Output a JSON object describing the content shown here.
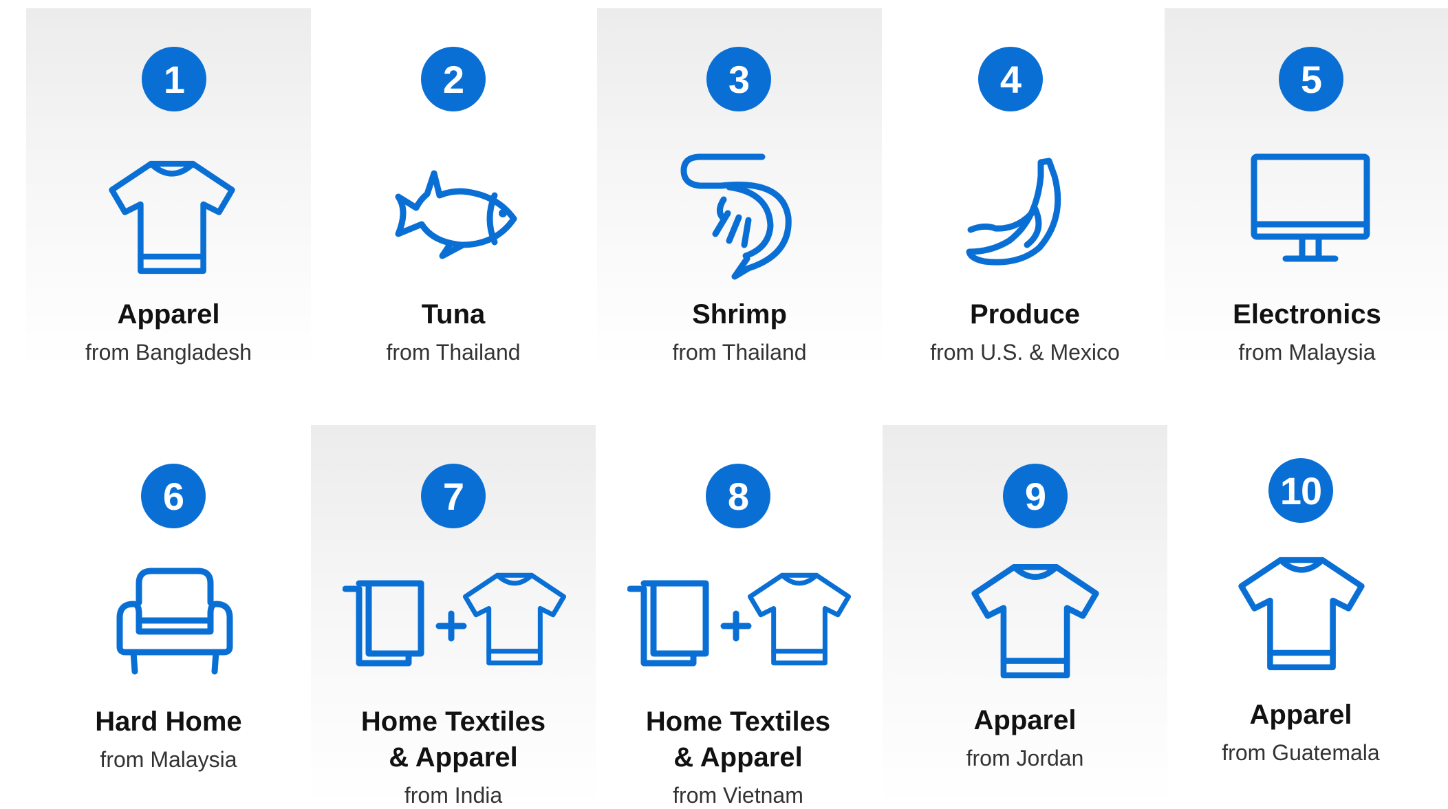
{
  "accent_color": "#0a6fd4",
  "items": [
    {
      "rank": "1",
      "title": "Apparel",
      "origin": "from Bangladesh",
      "icon": "tshirt-icon"
    },
    {
      "rank": "2",
      "title": "Tuna",
      "origin": "from Thailand",
      "icon": "fish-icon"
    },
    {
      "rank": "3",
      "title": "Shrimp",
      "origin": "from Thailand",
      "icon": "shrimp-icon"
    },
    {
      "rank": "4",
      "title": "Produce",
      "origin": "from U.S. & Mexico",
      "icon": "banana-icon"
    },
    {
      "rank": "5",
      "title": "Electronics",
      "origin": "from Malaysia",
      "icon": "monitor-icon"
    },
    {
      "rank": "6",
      "title": "Hard Home",
      "origin": "from Malaysia",
      "icon": "armchair-icon"
    },
    {
      "rank": "7",
      "title_line1": "Home Textiles",
      "title_line2": "& Apparel",
      "origin": "from India",
      "icon": "towel-plus-tshirt-icon"
    },
    {
      "rank": "8",
      "title_line1": "Home Textiles",
      "title_line2": "& Apparel",
      "origin": "from Vietnam",
      "icon": "towel-plus-tshirt-icon"
    },
    {
      "rank": "9",
      "title": "Apparel",
      "origin": "from Jordan",
      "icon": "tshirt-icon"
    },
    {
      "rank": "10",
      "title": "Apparel",
      "origin": "from Guatemala",
      "icon": "tshirt-icon"
    }
  ]
}
